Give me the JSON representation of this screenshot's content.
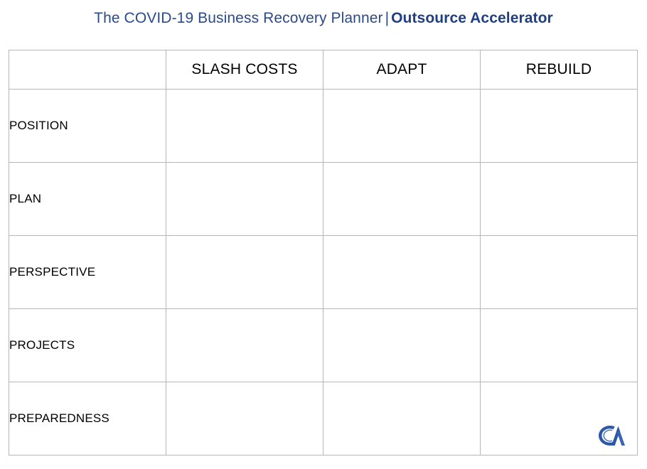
{
  "header": {
    "title_regular": "The COVID-19 Business Recovery Planner",
    "separator": "|",
    "title_bold": "Outsource Accelerator",
    "title_color": "#2b4a8b",
    "title_bold_color": "#1f3f82"
  },
  "table": {
    "corner_label": "",
    "columns": [
      {
        "label": "SLASH COSTS"
      },
      {
        "label": "ADAPT"
      },
      {
        "label": "REBUILD"
      }
    ],
    "rows": [
      {
        "label": "POSITION",
        "cells": [
          "",
          "",
          ""
        ]
      },
      {
        "label": "PLAN",
        "cells": [
          "",
          "",
          ""
        ]
      },
      {
        "label": "PERSPECTIVE",
        "cells": [
          "",
          "",
          ""
        ]
      },
      {
        "label": "PROJECTS",
        "cells": [
          "",
          "",
          ""
        ]
      },
      {
        "label": "PREPAREDNESS",
        "cells": [
          "",
          "",
          ""
        ]
      }
    ],
    "header_background": "#f2f2f2",
    "row_header_background": "#f2f2f2",
    "body_background": "#ffffff",
    "border_color": "#b6b6b6"
  },
  "logo": {
    "name": "outsource-accelerator-logo",
    "alt": "CA",
    "color": "#2e58a6"
  }
}
